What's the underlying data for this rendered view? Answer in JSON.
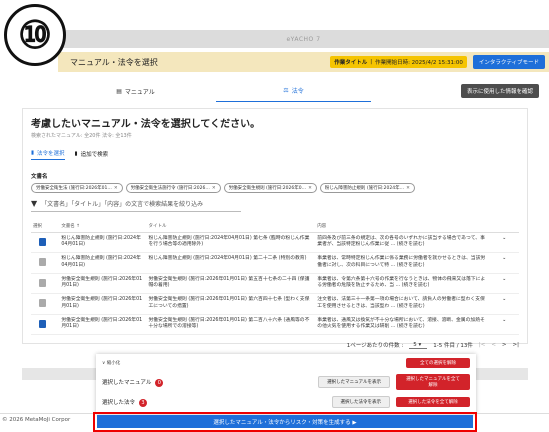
{
  "step": "⑩",
  "app": {
    "brand": "eYACHO 7"
  },
  "header": {
    "title": "マニュアル・法令を選択",
    "task_label": "作業タイトル",
    "task_start": "作業開始日時: 2025/4/2 15:31:00",
    "interactive_mode": "インタラクティブモード"
  },
  "tabs": {
    "manual": "マニュアル",
    "law": "法令",
    "show_used": "表示に使用した情報を確認"
  },
  "main": {
    "title": "考慮したいマニュアル・法令を選択してください。",
    "subtitle": "検索されたマニュアル: 全20件 法令: 全13件",
    "method_tabs": [
      "法令を選択",
      "追加で検索"
    ],
    "doc_label": "文書名",
    "chips": [
      "労働安全衛生法 (施行日:2026年01…",
      "労働安全衛生法施行令 (施行日:2026…",
      "労働安全衛生規則 (施行日:2026年0…",
      "粉じん障害防止規則 (施行日:2024年…"
    ],
    "filter_placeholder": "「文書名」「タイトル」「内容」の文言で検索結果を絞り込み"
  },
  "table": {
    "headers": [
      "選択",
      "文書名 ↑",
      "タイトル",
      "内容"
    ],
    "rows": [
      {
        "selected": true,
        "doc": "粉じん障害防止規則 (施行日:2024年04月01日)",
        "title": "粉じん障害防止規則 (施行日:2024年04月01日) 第七条 (臨時の粉じん作業を行う場合等の適用除外)",
        "content": "前四条及び前三条の規定は、次の各号のいずれかに該当する場合であつて、事業者が、当該特定粉じん作業に従 ... (続きを読む)"
      },
      {
        "selected": false,
        "doc": "粉じん障害防止規則 (施行日:2024年04月01日)",
        "title": "粉じん障害防止規則 (施行日:2024年04月01日) 第二十二条 (特別の教育)",
        "content": "事業者は、常時特定粉じん作業に係る業務に労働者を就かせるときは、当該労働者に対し、次の科目について特 ... (続きを読む)"
      },
      {
        "selected": false,
        "doc": "労働安全衛生規則 (施行日:2026年01月01日)",
        "title": "労働安全衛生規則 (施行日:2026年01月01日) 第五百十七条の二十四 (保護帽の着用)",
        "content": "事業者は、令第六条第十六号の作業を行なうときは、物体の飛来又は落下による労働者の危険を防止するため、当 ... (続きを読む)"
      },
      {
        "selected": false,
        "doc": "労働安全衛生規則 (施行日:2026年01月01日)",
        "title": "労働安全衛生規則 (施行日:2026年01月01日) 第六百四十七条 (型わく支保工についての措置)",
        "content": "注文者は、法第三十一条第一項の場合において、請負人の労働者に型わく支保工を使用させるときは、当該型わ ... (続きを読む)"
      },
      {
        "selected": true,
        "doc": "労働安全衛生規則 (施行日:2026年01月01日)",
        "title": "労働安全衛生規則 (施行日:2026年01月01日) 第二百八十六条 (通風等の不十分な場所での溶接等)",
        "content": "事業者は、通風又は換気が不十分な場所において、溶接、溶断、金属の加熱その他火気を使用する作業又は研削 ... (続きを読む)"
      }
    ]
  },
  "pager": {
    "per_page_label": "1ページあたりの件数 :",
    "per_page": "5",
    "range": "1-5 件目 / 13件"
  },
  "selection_panel": {
    "collapse": "∨ 縮小化",
    "clear_all": "全ての選択を解除",
    "manual_label": "選択したマニュアル",
    "manual_count": "0",
    "manual_show": "選択したマニュアルを表示",
    "manual_clear": "選択したマニュアルを全て解除",
    "law_label": "選択した法令",
    "law_count": "3",
    "law_show": "選択した法令を表示",
    "law_clear": "選択した法令を全て解除"
  },
  "footer": {
    "copyright": "© 2026 MetaMoJi Corpor"
  },
  "cta": {
    "label": "選択したマニュアル・法令からリスク・対策を生成する ▶"
  }
}
